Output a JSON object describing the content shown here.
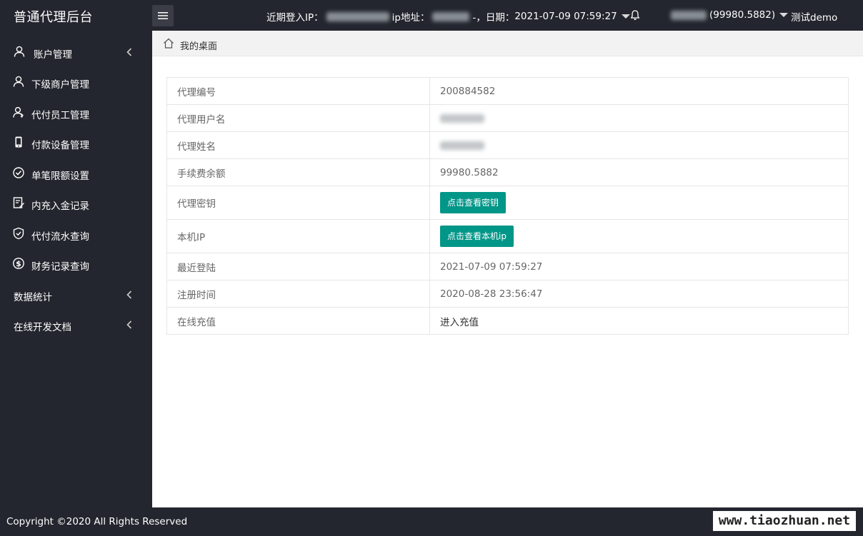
{
  "header": {
    "brand": "普通代理后台",
    "login_ip_label": "近期登入IP：",
    "ip_addr_label": "ip地址：",
    "date_prefix": "-，日期：",
    "date_value": "2021-07-09 07:59:27",
    "balance_text": "(99980.5882)",
    "user_name": "测试demo"
  },
  "sidebar": {
    "items": [
      {
        "label": "账户管理",
        "icon": "user-icon",
        "has_submenu": true
      },
      {
        "label": "下级商户管理",
        "icon": "user-icon"
      },
      {
        "label": "代付员工管理",
        "icon": "users-icon"
      },
      {
        "label": "付款设备管理",
        "icon": "phone-icon"
      },
      {
        "label": "单笔限额设置",
        "icon": "check-circle-icon"
      },
      {
        "label": "内充入金记录",
        "icon": "edit-icon"
      },
      {
        "label": "代付流水查询",
        "icon": "shield-icon"
      },
      {
        "label": "财务记录查询",
        "icon": "dollar-circle-icon"
      },
      {
        "label": "数据统计",
        "has_submenu": true
      },
      {
        "label": "在线开发文档",
        "has_submenu": true
      }
    ]
  },
  "breadcrumb": {
    "label": "我的桌面",
    "icon": "home-icon"
  },
  "info": {
    "rows": [
      {
        "key": "代理编号",
        "value": "200884582"
      },
      {
        "key": "代理用户名",
        "value": ""
      },
      {
        "key": "代理姓名",
        "value": ""
      },
      {
        "key": "手续费余额",
        "value": "99980.5882"
      },
      {
        "key": "代理密钥",
        "button": "点击查看密钥"
      },
      {
        "key": "本机IP",
        "button": "点击查看本机ip"
      },
      {
        "key": "最近登陆",
        "value": "2021-07-09 07:59:27"
      },
      {
        "key": "注册时间",
        "value": "2020-08-28 23:56:47"
      },
      {
        "key": "在线充值",
        "value": "进入充值"
      }
    ]
  },
  "footer": {
    "copyright": "Copyright ©2020 All Rights Reserved",
    "watermark": "www.tiaozhuan.net"
  },
  "colors": {
    "dark_bg": "#23262e",
    "accent": "#009688",
    "crumb_bg": "#f2f2f2",
    "border": "#e6e6e6"
  }
}
